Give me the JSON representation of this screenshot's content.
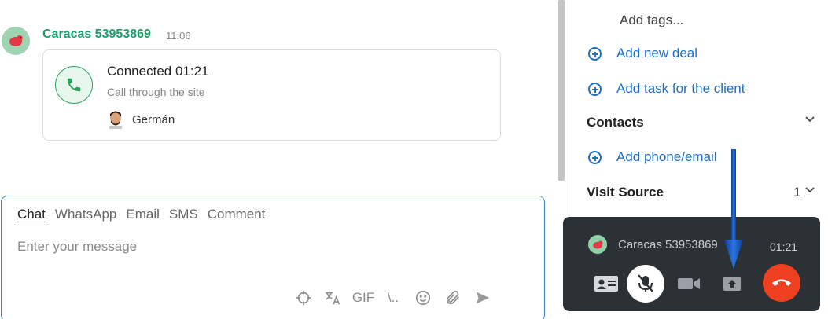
{
  "chat": {
    "message": {
      "sender": "Caracas 53953869",
      "time": "11:06",
      "call_status": "Connected 01:21",
      "call_subtitle": "Call through the site",
      "agent": "Germán"
    }
  },
  "composer": {
    "tabs": [
      "Chat",
      "WhatsApp",
      "Email",
      "SMS",
      "Comment"
    ],
    "active_tab": "Chat",
    "placeholder": "Enter your message",
    "tools": {
      "target": "target-icon",
      "translate": "translate-icon",
      "gif": "GIF",
      "templates": "\\..",
      "emoji": "emoji-icon",
      "attach": "paperclip-icon",
      "send": "send-icon"
    }
  },
  "panel": {
    "add_tags": "Add tags...",
    "add_deal": "Add new deal",
    "add_task": "Add task for the client",
    "contacts_title": "Contacts",
    "add_phone": "Add phone/email",
    "visit_source_title": "Visit Source",
    "visit_source_count": "1"
  },
  "widget": {
    "caller": "Caracas 53953869",
    "timer": "01:21"
  },
  "colors": {
    "accent_green": "#1aa06a",
    "link_blue": "#1f6fc5",
    "hangup_red": "#ef4022",
    "widget_bg": "#2c3136",
    "annotation_arrow": "#1358c0"
  }
}
